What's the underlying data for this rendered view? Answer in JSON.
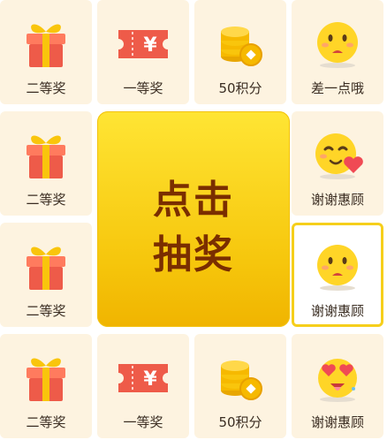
{
  "center_button": {
    "line1": "点击",
    "line2": "抽奖"
  },
  "cells": [
    {
      "label": "二等奖",
      "icon": "gift-icon"
    },
    {
      "label": "一等奖",
      "icon": "ticket-icon"
    },
    {
      "label": "50积分",
      "icon": "coins-icon"
    },
    {
      "label": "差一点哦",
      "icon": "sad-face-icon"
    },
    {
      "label": "谢谢惠顾",
      "icon": "face-heart-icon"
    },
    {
      "label": "谢谢惠顾",
      "icon": "sad-face-icon"
    },
    {
      "label": "谢谢惠顾",
      "icon": "heart-eyes-face-icon"
    },
    {
      "label": "50积分",
      "icon": "coins-icon"
    },
    {
      "label": "一等奖",
      "icon": "ticket-icon"
    },
    {
      "label": "二等奖",
      "icon": "gift-icon"
    },
    {
      "label": "二等奖",
      "icon": "gift-icon"
    },
    {
      "label": "二等奖",
      "icon": "gift-icon"
    }
  ],
  "ticket_symbol": "¥",
  "colors": {
    "cell_background": "#fdf3e0",
    "active_border": "#f6cf1b",
    "center_yellow": "#fcd91a",
    "center_text": "#7a2e00",
    "gift_red": "#ee5b49",
    "gold": "#f6c60c"
  }
}
